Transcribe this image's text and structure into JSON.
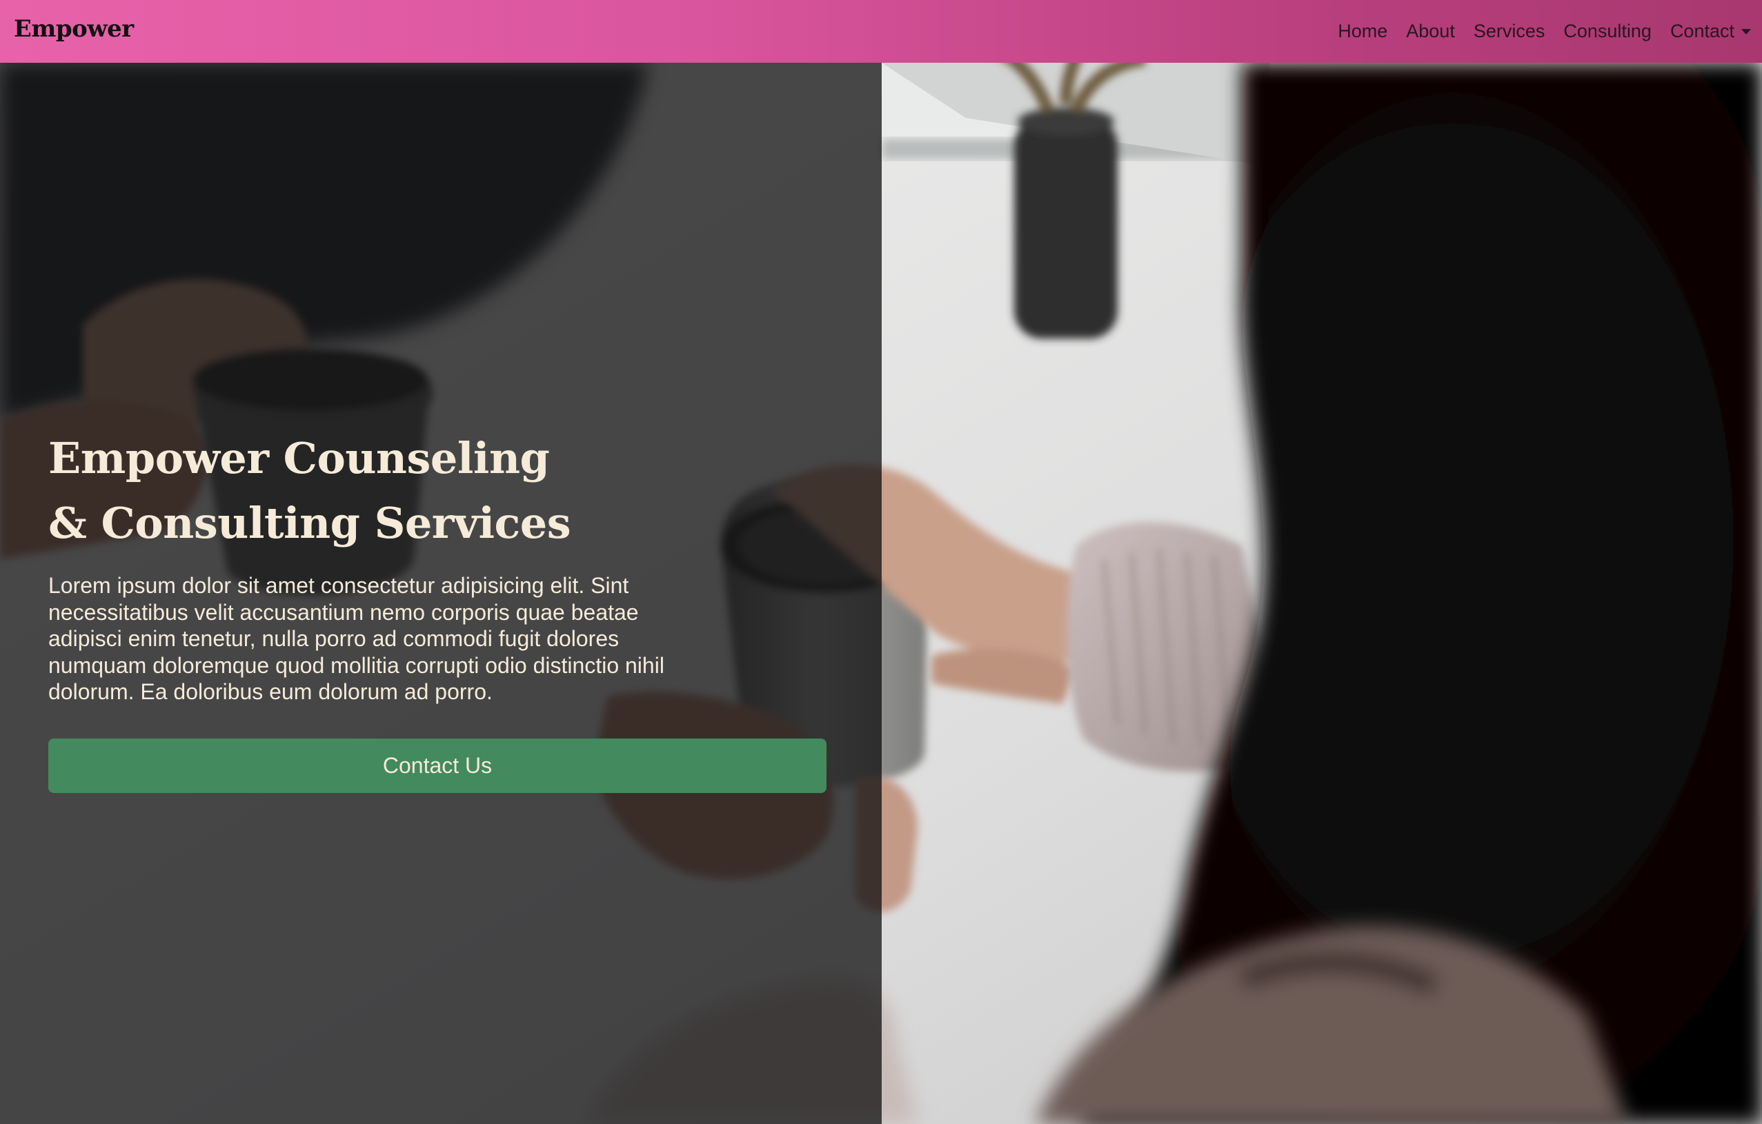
{
  "navbar": {
    "brand": "Empower",
    "links": [
      {
        "label": "Home"
      },
      {
        "label": "About"
      },
      {
        "label": "Services"
      },
      {
        "label": "Consulting"
      },
      {
        "label": "Contact"
      }
    ]
  },
  "hero": {
    "title_line1": "Empower Counseling",
    "title_line2": "& Consulting Services",
    "body": "Lorem ipsum dolor sit amet consectetur adipisicing elit. Sint necessitatibus velit accusantium nemo corporis quae beatae adipisci enim tenetur, nulla porro ad commodi fugit dolores numquam doloremque quod mollitia corrupti odio distinctio nihil dolorum. Ea doloribus eum dolorum ad porro.",
    "cta_label": "Contact Us"
  },
  "colors": {
    "navbar_gradient_start": "#e862aa",
    "navbar_gradient_end": "#a8386f",
    "hero_text": "#f6ebd9",
    "cta_background": "#438a5e"
  },
  "icons": {
    "contact_dropdown": "chevron-down-icon"
  }
}
